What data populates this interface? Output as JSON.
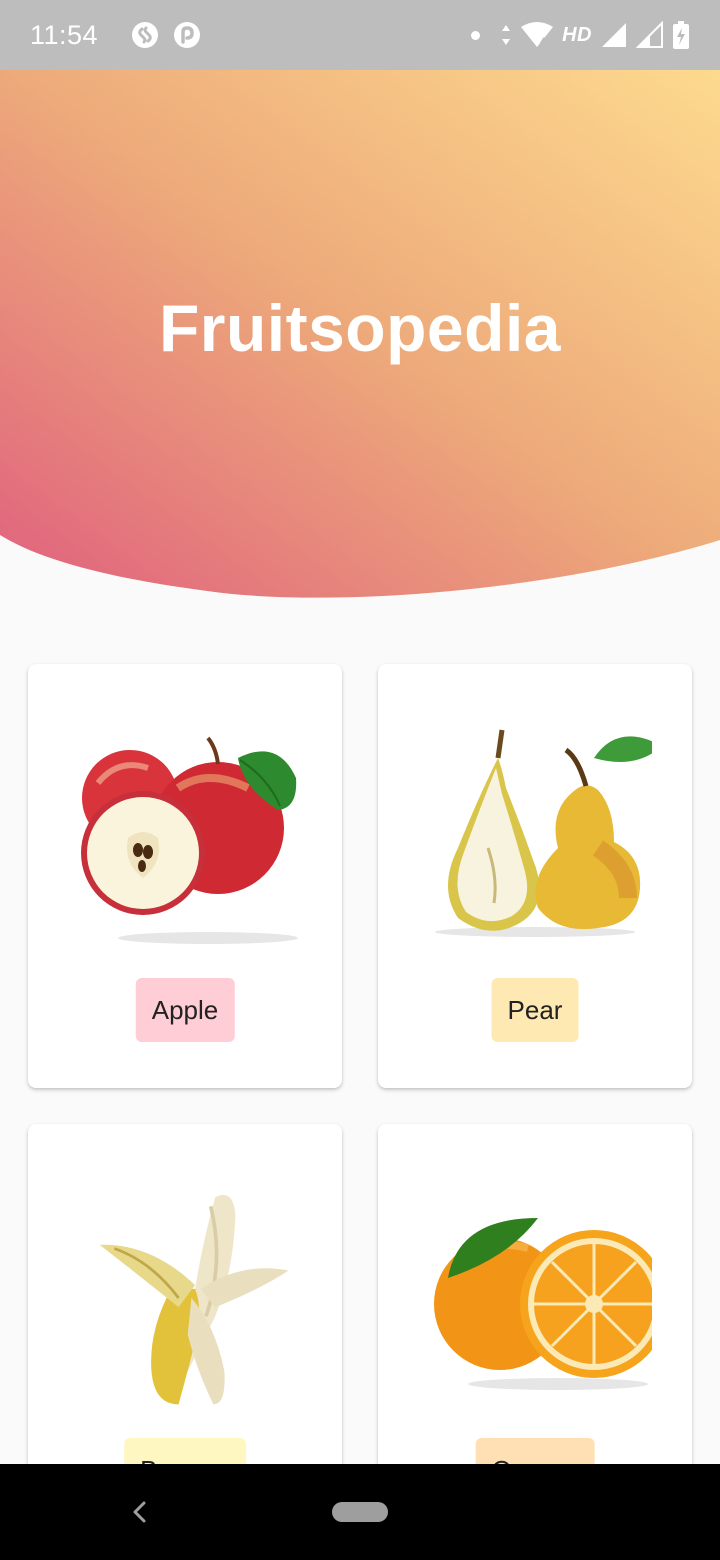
{
  "status_bar": {
    "time": "11:54",
    "network_label": "HD",
    "left_icons": [
      "shazam-icon",
      "pocket-casts-icon"
    ],
    "right_icons": [
      "notification-dot-icon",
      "data-arrows-icon",
      "wifi-icon",
      "signal-icon",
      "signal-icon",
      "battery-icon"
    ]
  },
  "header": {
    "title": "Fruitsopedia",
    "gradient_start": "#e0607e",
    "gradient_mid": "#eda97a",
    "gradient_end": "#fdda8e"
  },
  "fruits": [
    {
      "name": "Apple",
      "label_bg": "#ffcdd6",
      "icon": "apple-icon"
    },
    {
      "name": "Pear",
      "label_bg": "#ffe9b3",
      "icon": "pear-icon"
    },
    {
      "name": "Banana",
      "label_bg": "#fff7c2",
      "icon": "banana-icon"
    },
    {
      "name": "Orange",
      "label_bg": "#ffe0b5",
      "icon": "orange-icon"
    }
  ],
  "nav_bar": {
    "back_icon": "back-chevron-icon",
    "home_icon": "home-pill-icon"
  }
}
